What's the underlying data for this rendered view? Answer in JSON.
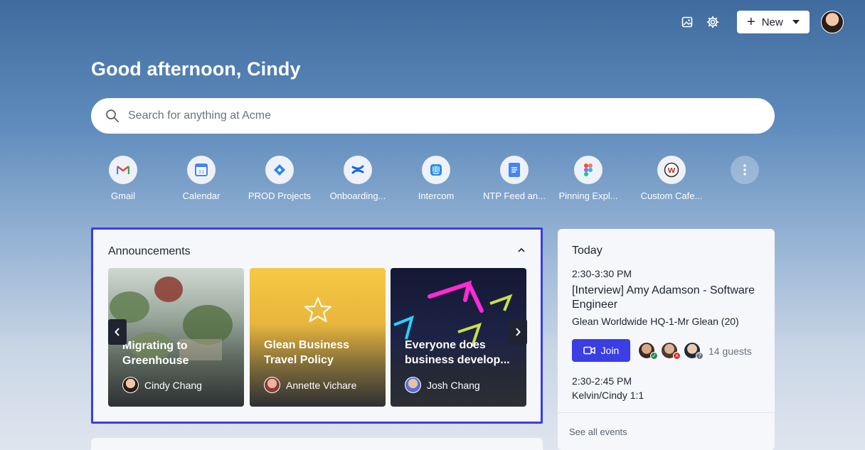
{
  "header": {
    "new_label": "New",
    "greeting": "Good afternoon, Cindy"
  },
  "search": {
    "placeholder": "Search for anything at Acme"
  },
  "shortcuts": [
    {
      "label": "Gmail",
      "icon": "gmail-icon"
    },
    {
      "label": "Calendar",
      "icon": "google-calendar-icon"
    },
    {
      "label": "PROD Projects",
      "icon": "jira-icon"
    },
    {
      "label": "Onboarding...",
      "icon": "confluence-icon"
    },
    {
      "label": "Intercom",
      "icon": "intercom-icon"
    },
    {
      "label": "NTP Feed an...",
      "icon": "google-docs-icon"
    },
    {
      "label": "Pinning Expl...",
      "icon": "figma-icon"
    },
    {
      "label": "Custom Cafe...",
      "icon": "cafe-logo-icon"
    }
  ],
  "announcements": {
    "title": "Announcements",
    "cards": [
      {
        "title": "Migrating to Greenhouse",
        "author": "Cindy Chang"
      },
      {
        "title": "Glean Business Travel Policy",
        "author": "Annette Vichare"
      },
      {
        "title": "Everyone does business develop...",
        "author": "Josh Chang"
      }
    ]
  },
  "today": {
    "title": "Today",
    "events": [
      {
        "time": "2:30-3:30 PM",
        "title": "[Interview] Amy Adamson - Software Engineer",
        "location": "Glean Worldwide HQ-1-Mr Glean (20)",
        "join_label": "Join",
        "guests": "14 guests"
      },
      {
        "time": "2:30-2:45 PM",
        "title": "Kelvin/Cindy 1:1"
      }
    ],
    "see_all": "See all events"
  },
  "colors": {
    "accent": "#3a3ee3",
    "gmail_red": "#ea4335",
    "jira_blue": "#2684ff",
    "status_accepted": "#1e8e3e",
    "status_declined": "#d93025",
    "status_maybe": "#6b7280"
  }
}
